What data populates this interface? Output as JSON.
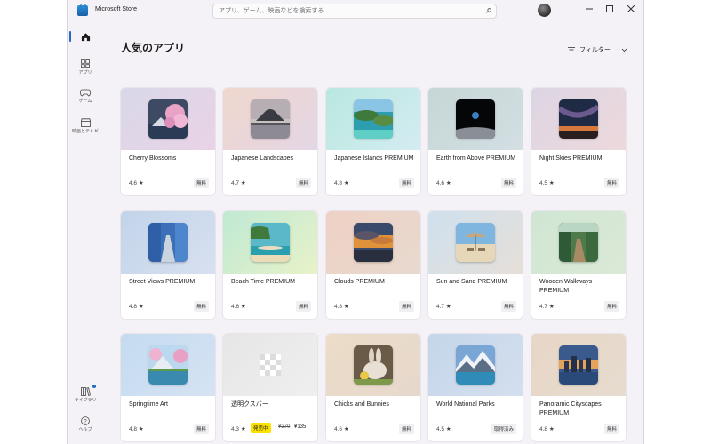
{
  "app": {
    "title": "Microsoft Store"
  },
  "search": {
    "placeholder": "アプリ、ゲーム、映画などを検索する"
  },
  "nav": {
    "items": [
      {
        "id": "home",
        "label": ""
      },
      {
        "id": "apps",
        "label": "アプリ"
      },
      {
        "id": "games",
        "label": "ゲーム"
      },
      {
        "id": "movies",
        "label": "映画とテレビ"
      }
    ],
    "bottom": [
      {
        "id": "library",
        "label": "ライブラリ"
      },
      {
        "id": "help",
        "label": "ヘルプ"
      }
    ]
  },
  "page": {
    "title": "人気のアプリ",
    "filter_label": "フィルター"
  },
  "colors": {
    "accent": "#1e6bc3",
    "sale_badge": "#fce100"
  },
  "cards": [
    {
      "name": "Cherry Blossoms",
      "rating": "4.6 ★",
      "price": "無料",
      "icon": "cherry-blossom-thumbnail"
    },
    {
      "name": "Japanese Landscapes",
      "rating": "4.7 ★",
      "price": "無料",
      "icon": "mount-fuji-thumbnail"
    },
    {
      "name": "Japanese Islands PREMIUM",
      "rating": "4.8 ★",
      "price": "無料",
      "icon": "islands-thumbnail"
    },
    {
      "name": "Earth from Above PREMIUM",
      "rating": "4.6 ★",
      "price": "無料",
      "icon": "earth-thumbnail"
    },
    {
      "name": "Night Skies PREMIUM",
      "rating": "4.5 ★",
      "price": "無料",
      "icon": "night-sky-thumbnail"
    },
    {
      "name": "Street Views PREMIUM",
      "rating": "4.8 ★",
      "price": "無料",
      "icon": "blue-street-thumbnail"
    },
    {
      "name": "Beach Time PREMIUM",
      "rating": "4.6 ★",
      "price": "無料",
      "icon": "beach-thumbnail"
    },
    {
      "name": "Clouds PREMIUM",
      "rating": "4.8 ★",
      "price": "無料",
      "icon": "clouds-thumbnail"
    },
    {
      "name": "Sun and Sand PREMIUM",
      "rating": "4.7 ★",
      "price": "無料",
      "icon": "sun-sand-thumbnail"
    },
    {
      "name": "Wooden Walkways PREMIUM",
      "rating": "4.7 ★",
      "price": "無料",
      "icon": "walkway-thumbnail"
    },
    {
      "name": "Springtime Art",
      "rating": "4.8 ★",
      "price": "無料",
      "icon": "springtime-art-thumbnail"
    },
    {
      "name": "透明クスバー",
      "rating": "4.3 ★",
      "price": "",
      "sale_badge": "発売中",
      "original_price": "¥270",
      "sale_price": "¥135",
      "icon": "transparent-checker-thumbnail"
    },
    {
      "name": "Chicks and Bunnies",
      "rating": "4.6 ★",
      "price": "無料",
      "icon": "bunny-thumbnail"
    },
    {
      "name": "World National Parks",
      "rating": "4.5 ★",
      "price": "取得済み",
      "icon": "national-park-thumbnail"
    },
    {
      "name": "Panoramic Cityscapes PREMIUM",
      "rating": "4.8 ★",
      "price": "無料",
      "icon": "cityscape-thumbnail"
    }
  ]
}
